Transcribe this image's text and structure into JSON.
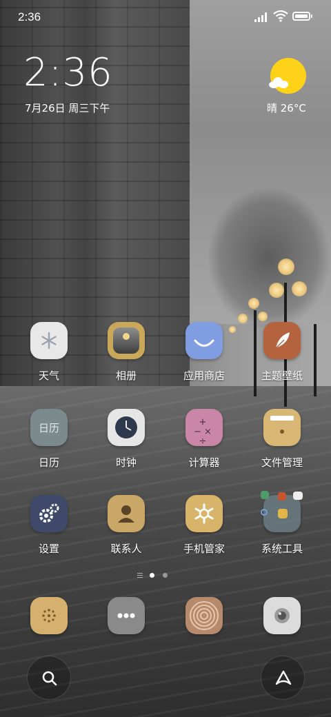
{
  "status_bar": {
    "time": "2:36",
    "icons": [
      "signal-icon",
      "wifi-icon",
      "battery-icon"
    ]
  },
  "clock_widget": {
    "time": "2:36",
    "date": "7月26日 周三下午"
  },
  "weather_widget": {
    "condition_temp": "晴 26°C",
    "icon": "sunny-cloud-icon"
  },
  "apps": [
    {
      "label": "天气",
      "icon": "weather-snowflake-icon"
    },
    {
      "label": "相册",
      "icon": "gallery-icon"
    },
    {
      "label": "应用商店",
      "icon": "app-store-icon"
    },
    {
      "label": "主题壁纸",
      "icon": "theme-feather-icon"
    },
    {
      "label": "日历",
      "icon": "calendar-icon",
      "icon_text": "日历"
    },
    {
      "label": "时钟",
      "icon": "clock-icon"
    },
    {
      "label": "计算器",
      "icon": "calculator-icon",
      "icon_text": "+−×÷"
    },
    {
      "label": "文件管理",
      "icon": "file-manager-icon"
    },
    {
      "label": "设置",
      "icon": "settings-gear-icon"
    },
    {
      "label": "联系人",
      "icon": "contacts-icon"
    },
    {
      "label": "手机管家",
      "icon": "security-manager-icon"
    },
    {
      "label": "系统工具",
      "icon": "system-tools-folder-icon"
    }
  ],
  "page_indicator": {
    "pages": 2,
    "current": 1
  },
  "dock": [
    {
      "icon": "phone-keypad-icon"
    },
    {
      "icon": "messages-icon"
    },
    {
      "icon": "browser-icon"
    },
    {
      "icon": "camera-icon"
    }
  ],
  "bottom_bar": {
    "left_icon": "search-icon",
    "right_icon": "assistant-icon"
  },
  "colors": {
    "sun": "#ffd21a",
    "weather_bg": "#e8e8e8",
    "gallery_bg": "#c9a85a",
    "appstore_bg": "#7f9de0",
    "theme_bg": "#b5623f",
    "calendar_bg": "#7b8a8d",
    "clock_bg": "#e6e6e6",
    "calculator_bg": "#c986a6",
    "file_bg": "#d8b775",
    "settings_bg": "#3f4a6b",
    "contacts_bg": "#c9a766",
    "security_bg": "#d7b46a",
    "dock_phone_bg": "#d5b06e",
    "dock_msg_bg": "#8a8a8a",
    "dock_browser_bg": "#b88a6c",
    "dock_camera_bg": "#dcdcdc"
  }
}
